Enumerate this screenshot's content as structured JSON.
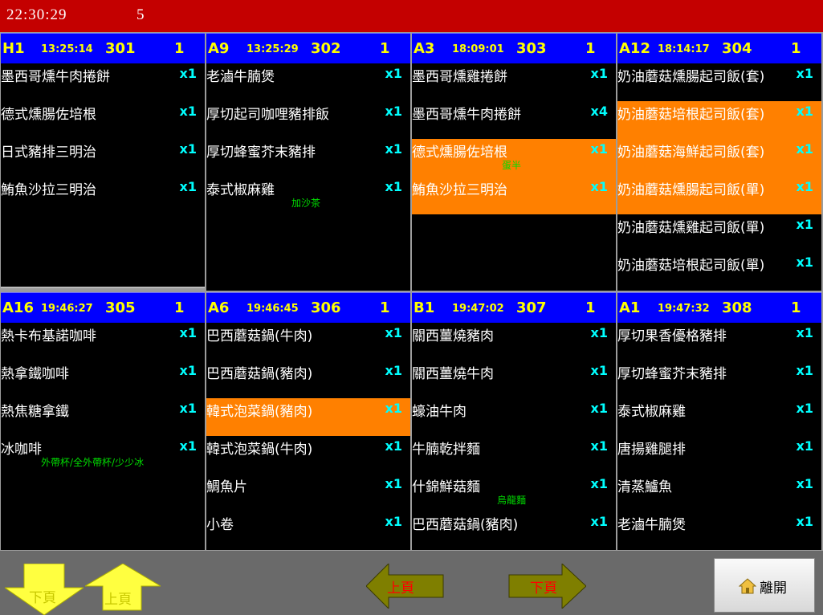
{
  "header": {
    "clock": "22:30:29",
    "page_count": "5"
  },
  "tickets": [
    {
      "table": "H1",
      "time": "13:25:14",
      "no": "301",
      "count": "1",
      "items": [
        {
          "name": "墨西哥燻牛肉捲餅",
          "qty": "x1"
        },
        {
          "name": "德式燻腸佐培根",
          "qty": "x1"
        },
        {
          "name": "日式豬排三明治",
          "qty": "x1"
        },
        {
          "name": "鮪魚沙拉三明治",
          "qty": "x1"
        }
      ]
    },
    {
      "table": "A9",
      "time": "13:25:29",
      "no": "302",
      "count": "1",
      "items": [
        {
          "name": "老滷牛腩煲",
          "qty": "x1"
        },
        {
          "name": "厚切起司咖哩豬排飯",
          "qty": "x1"
        },
        {
          "name": "厚切蜂蜜芥末豬排",
          "qty": "x1"
        },
        {
          "name": "泰式椒麻雞",
          "qty": "x1",
          "note": "加沙茶"
        }
      ]
    },
    {
      "table": "A3",
      "time": "18:09:01",
      "no": "303",
      "count": "1",
      "items": [
        {
          "name": "墨西哥燻雞捲餅",
          "qty": "x1"
        },
        {
          "name": "墨西哥燻牛肉捲餅",
          "qty": "x4"
        },
        {
          "name": "德式燻腸佐培根",
          "qty": "x1",
          "highlight": true,
          "note": "蛋半"
        },
        {
          "name": "鮪魚沙拉三明治",
          "qty": "x1",
          "highlight": true
        }
      ]
    },
    {
      "table": "A12",
      "time": "18:14:17",
      "no": "304",
      "count": "1",
      "items": [
        {
          "name": "奶油蘑菇燻腸起司飯(套)",
          "qty": "x1"
        },
        {
          "name": "奶油蘑菇培根起司飯(套)",
          "qty": "x1",
          "highlight": true
        },
        {
          "name": "奶油蘑菇海鮮起司飯(套)",
          "qty": "x1",
          "highlight": true
        },
        {
          "name": "奶油蘑菇燻腸起司飯(單)",
          "qty": "x1",
          "highlight": true
        },
        {
          "name": "奶油蘑菇燻雞起司飯(單)",
          "qty": "x1"
        },
        {
          "name": "奶油蘑菇培根起司飯(單)",
          "qty": "x1"
        }
      ]
    },
    {
      "table": "A16",
      "time": "19:46:27",
      "no": "305",
      "count": "1",
      "items": [
        {
          "name": "熱卡布基諾咖啡",
          "qty": "x1"
        },
        {
          "name": "熱拿鐵咖啡",
          "qty": "x1"
        },
        {
          "name": "熱焦糖拿鐵",
          "qty": "x1"
        },
        {
          "name": "冰咖啡",
          "qty": "x1",
          "note": "外帶杯/全外帶杯/少少冰"
        }
      ]
    },
    {
      "table": "A6",
      "time": "19:46:45",
      "no": "306",
      "count": "1",
      "items": [
        {
          "name": "巴西蘑菇鍋(牛肉)",
          "qty": "x1"
        },
        {
          "name": "巴西蘑菇鍋(豬肉)",
          "qty": "x1"
        },
        {
          "name": "韓式泡菜鍋(豬肉)",
          "qty": "x1",
          "highlight": true
        },
        {
          "name": "韓式泡菜鍋(牛肉)",
          "qty": "x1"
        },
        {
          "name": "鯛魚片",
          "qty": "x1"
        },
        {
          "name": "小卷",
          "qty": "x1"
        }
      ]
    },
    {
      "table": "B1",
      "time": "19:47:02",
      "no": "307",
      "count": "1",
      "items": [
        {
          "name": "關西薑燒豬肉",
          "qty": "x1"
        },
        {
          "name": "關西薑燒牛肉",
          "qty": "x1"
        },
        {
          "name": "蠔油牛肉",
          "qty": "x1"
        },
        {
          "name": "牛腩乾拌麵",
          "qty": "x1"
        },
        {
          "name": "什錦鮮菇麵",
          "qty": "x1",
          "note": "烏龍麵"
        },
        {
          "name": "巴西蘑菇鍋(豬肉)",
          "qty": "x1"
        }
      ]
    },
    {
      "table": "A1",
      "time": "19:47:32",
      "no": "308",
      "count": "1",
      "items": [
        {
          "name": "厚切果香優格豬排",
          "qty": "x1"
        },
        {
          "name": "厚切蜂蜜芥末豬排",
          "qty": "x1"
        },
        {
          "name": "泰式椒麻雞",
          "qty": "x1"
        },
        {
          "name": "唐揚雞腿排",
          "qty": "x1"
        },
        {
          "name": "清蒸鱸魚",
          "qty": "x1"
        },
        {
          "name": "老滷牛腩煲",
          "qty": "x1"
        }
      ]
    }
  ],
  "nav": {
    "down_label_1": "下頁",
    "up_label_1": "上頁",
    "up_label_2": "上頁",
    "down_label_2": "下頁",
    "exit_label": "離開",
    "exit_icon": "home-icon"
  },
  "colors": {
    "topbar": "#c40000",
    "ticket_header": "#0000ff",
    "ticket_header_text": "#ffff00",
    "highlight_row": "#ff8000",
    "quantity": "#00ffff",
    "note": "#00dd00"
  }
}
